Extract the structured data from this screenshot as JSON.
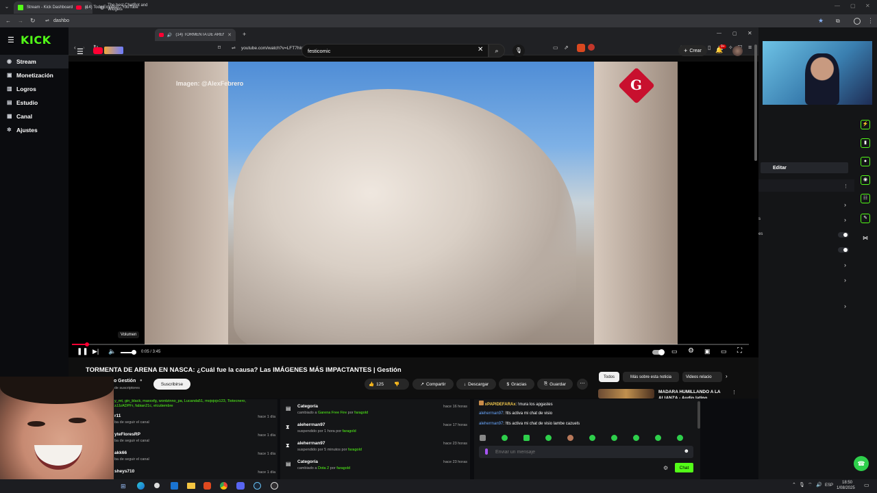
{
  "outer_tabs": [
    {
      "label": "Stream - Kick Dashboard",
      "active": true
    },
    {
      "label": "(14) Todo Empeso - YouTube",
      "active": false
    },
    {
      "label": "The best ChatBot and Widgets",
      "active": false
    }
  ],
  "outer_addr_prefix": "dashbo",
  "kick": {
    "logo": "KICK",
    "nav": [
      {
        "label": "Stream",
        "icon": "live-icon",
        "active": true
      },
      {
        "label": "Monetización",
        "icon": "money-icon"
      },
      {
        "label": "Logros",
        "icon": "trophy-icon"
      },
      {
        "label": "Estudio",
        "icon": "studio-icon"
      },
      {
        "label": "Canal",
        "icon": "channel-icon"
      },
      {
        "label": "Ajustes",
        "icon": "gear-icon"
      }
    ]
  },
  "inner_tabs": [
    {
      "label": "(14) TORMENTA DE ARENA E",
      "active": true
    }
  ],
  "url": "youtube.com/watch?v=LFT7hlc6-n0",
  "youtube": {
    "search_value": "festicomic",
    "create_label": "Crear",
    "notif_badge": "9+",
    "watermark": "Imagen: @AlexFebrero",
    "logo_letter": "G",
    "tooltip": "Volumen",
    "time": "0:05 / 3:45",
    "progress": 0.022,
    "title": "TORMENTA DE ARENA EN NASCA: ¿Cuál fue la causa? Las IMÁGENES MÁS IMPACTANTES | Gestión",
    "channel_name": "io Gestión",
    "subs_text": "l de suscriptores",
    "subscribe": "Suscribirse",
    "likes": "125",
    "share": "Compartir",
    "download": "Descargar",
    "thanks": "Gracias",
    "save": "Guardar",
    "chips": [
      "Todos",
      "Más sobre esta noticia",
      "Videos relacio"
    ],
    "rec_title_1": "MADARA HUMILLANDO A LA",
    "rec_title_2": "ALIANZA - Audio latino"
  },
  "right_panel": {
    "editar": "Editar",
    "frag_1": "s",
    "frag_2": "es"
  },
  "followers_line": "y_mt, gin_black, maxxxfg, wontzinno_pa, Lucanda51, mojojojo123, Tiotecnero,",
  "followers_line2": "zJJzADPFr, fabian21c, elcutiembre",
  "followers": [
    {
      "name": "r11",
      "sub": "ba de seguir el canal",
      "time": "hace 1 día"
    },
    {
      "name": "yteFloresRP",
      "sub": "ba de seguir el canal",
      "time": "hace 1 día"
    },
    {
      "name": "akk66",
      "sub": "ba de seguir el canal",
      "time": "hace 1 día"
    },
    {
      "name": "sheys710",
      "sub": "",
      "time": "hace 1 día"
    }
  ],
  "events": [
    {
      "title": "Categoría",
      "sub1": "cambiado a ",
      "hl": "Garena Free Fire",
      "sub2": " por ",
      "by": "faragold",
      "time": "hace 16 horas",
      "icon": "list-icon"
    },
    {
      "title": "aleherrnan97",
      "sub1": "suspendido por 1 hora por ",
      "hl": "",
      "sub2": "",
      "by": "faragold",
      "time": "hace 17 horas",
      "icon": "hourglass-icon"
    },
    {
      "title": "aleherrnan97",
      "sub1": "suspendido por 5 minutos por ",
      "hl": "",
      "sub2": "",
      "by": "faragold",
      "time": "hace 23 horas",
      "icon": "hourglass-icon"
    },
    {
      "title": "Categoría",
      "sub1": "cambiado a ",
      "hl": "Dota 2",
      "sub2": " por ",
      "by": "faragold",
      "time": "hace 23 horas",
      "icon": "list-icon"
    }
  ],
  "chat": {
    "messages": [
      {
        "user": "xPAPIDEFARAx",
        "text": "!mura los apgastes",
        "color": "#f3c94d"
      },
      {
        "user": "aleherrnan97",
        "text": "!tts activa mi chat de visio",
        "color": "#6aa8ff"
      },
      {
        "user": "aleherrnan97",
        "text": "!tts activa mi chat de visio lambe cazuels",
        "color": "#6aa8ff"
      }
    ],
    "placeholder": "Enviar un mensaje",
    "send": "Chat"
  },
  "taskbar": {
    "lang": "ESP",
    "time": "18:50",
    "date": "1/08/2025"
  },
  "colors": {
    "kick_green": "#53fc18",
    "yt_red": "#ff0033",
    "chip_active": "#f1f1f1"
  }
}
